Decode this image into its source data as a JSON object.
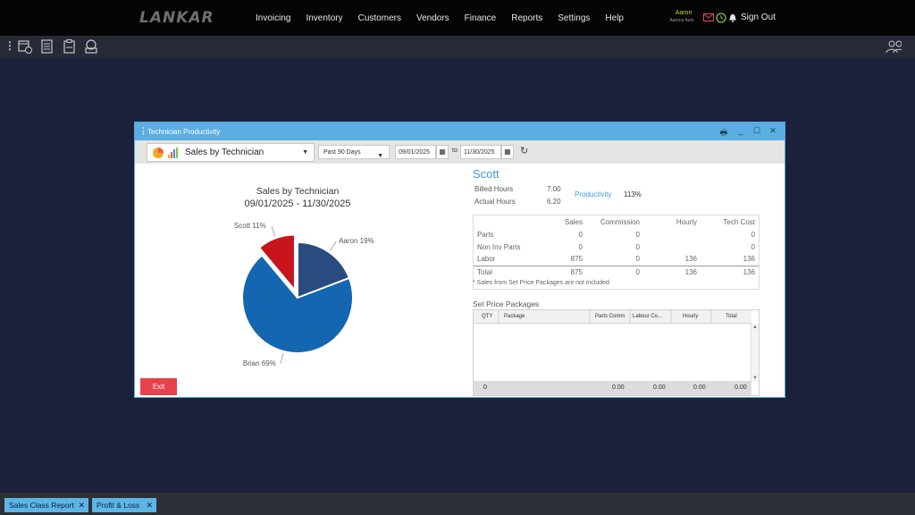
{
  "app": {
    "logo": "LANKAR"
  },
  "nav": {
    "items": [
      "Invoicing",
      "Inventory",
      "Customers",
      "Vendors",
      "Finance",
      "Reports",
      "Settings",
      "Help"
    ]
  },
  "user": {
    "name": "Aaron",
    "shop": "Aarons Auto",
    "signout": "Sign Out"
  },
  "window": {
    "title": "Technician Productivity",
    "report_select": "Sales by Technician",
    "period_select": "Past 90 Days",
    "date_from": "09/01/2025",
    "to_label": "to",
    "date_to": "11/30/2025",
    "exit_label": "Exit"
  },
  "chart_data": {
    "type": "pie",
    "title": "Sales by Technician",
    "subtitle": "09/01/2025 - 11/30/2025",
    "slices": [
      {
        "label": "Aaron 19%",
        "value": 19,
        "color": "#2a4b80"
      },
      {
        "label": "Brian 69%",
        "value": 69,
        "color": "#1466b0"
      },
      {
        "label": "Scott 11%",
        "value": 11,
        "color": "#c8141b",
        "exploded": true
      }
    ]
  },
  "tech": {
    "name": "Scott",
    "billed_label": "Billed Hours",
    "billed_value": "7.00",
    "actual_label": "Actual Hours",
    "actual_value": "6.20",
    "productivity_label": "Productivity",
    "productivity_value": "113%"
  },
  "sales_table": {
    "headers": [
      "",
      "Sales",
      "Commission",
      "Hourly",
      "Tech Cost"
    ],
    "rows": [
      [
        "Parts",
        "0",
        "0",
        "",
        "0"
      ],
      [
        "Non Inv Parts",
        "0",
        "0",
        "",
        "0"
      ],
      [
        "Labor",
        "875",
        "0",
        "136",
        "136"
      ],
      [
        "Total",
        "875",
        "0",
        "136",
        "136"
      ]
    ],
    "note": "* Sales from Set Price Packages are not included"
  },
  "packages": {
    "title": "Set Price Packages",
    "headers": [
      "QTY",
      "Package",
      "Parts Comm",
      "Labour Co...",
      "Hourly",
      "Total"
    ],
    "footer": [
      "0",
      "",
      "0.00",
      "0.00",
      "0.00",
      "0.00"
    ]
  },
  "taskbar": {
    "tabs": [
      "Sales Class Report",
      "Profit & Loss"
    ]
  }
}
